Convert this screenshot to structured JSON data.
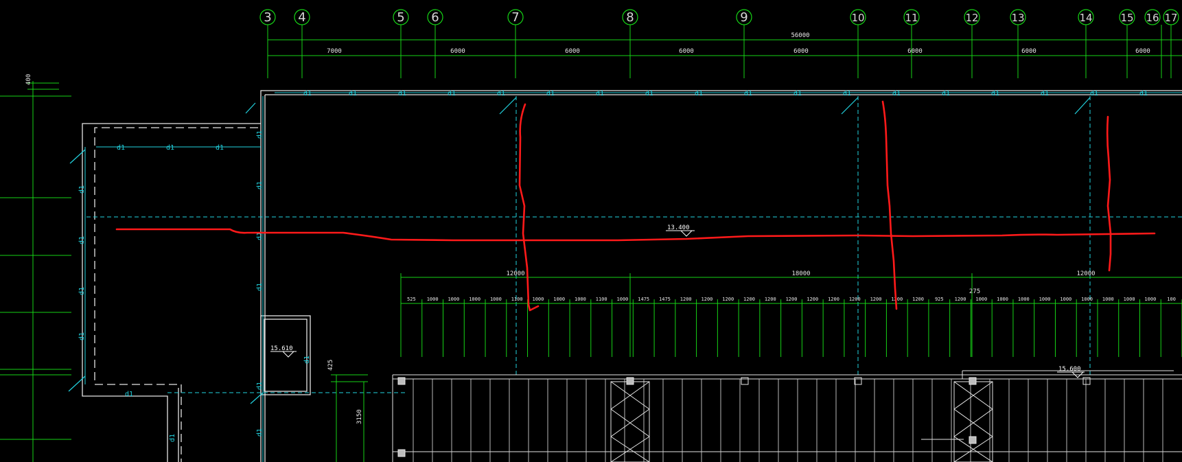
{
  "drawing": {
    "colors": {
      "background": "#000000",
      "axis_green": "#16d516",
      "wall_white": "#e6e6e6",
      "service_cyan": "#22d3e0",
      "markup_red": "#ff1a1a"
    },
    "axis_bubbles": [
      "3",
      "4",
      "5",
      "6",
      "7",
      "8",
      "9",
      "10",
      "11",
      "12",
      "13",
      "14",
      "15",
      "16",
      "17"
    ],
    "top_overall_dim": "56000",
    "top_bay_dims": [
      "7000",
      "6000",
      "6000",
      "6000",
      "6000",
      "6000",
      "6000",
      "6000"
    ],
    "left_small_dim": "400",
    "pipe_tag": "d1",
    "levels": {
      "main": "13.400",
      "room": "15.610",
      "right": "15.600"
    },
    "mid_group_dims": [
      "12000",
      "18000",
      "12000"
    ],
    "spacing_dims": [
      "525",
      "1000",
      "1000",
      "1000",
      "1000",
      "1100",
      "1000",
      "1000",
      "1000",
      "1100",
      "1000",
      "1475",
      "1475",
      "1200",
      "1200",
      "1200",
      "1200",
      "1200",
      "1200",
      "1200",
      "1200",
      "1200",
      "1200",
      "1200",
      "1200",
      "925",
      "1200",
      "1000",
      "1000",
      "1000",
      "1000",
      "1000",
      "1000",
      "1000",
      "1000",
      "1000",
      "100"
    ],
    "tick_275": "275",
    "left_v_dim_a": "425",
    "left_v_dim_b": "3150"
  }
}
